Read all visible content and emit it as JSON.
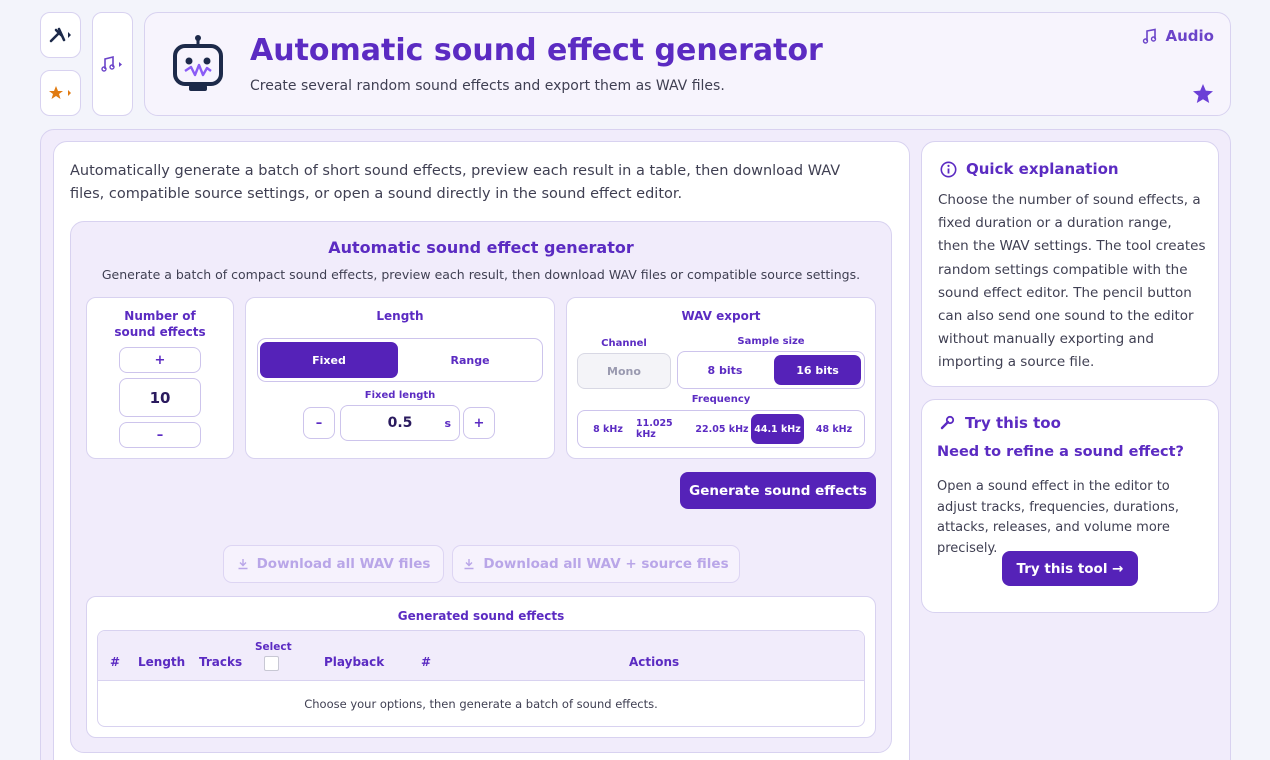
{
  "header": {
    "title": "Automatic sound effect generator",
    "subtitle": "Create several random sound effects and export them as WAV files.",
    "category": "Audio"
  },
  "intro": "Automatically generate a batch of short sound effects, preview each result in a table, then download WAV files, compatible source settings, or open a sound directly in the sound effect editor.",
  "tool": {
    "title": "Automatic sound effect generator",
    "subtitle": "Generate a batch of compact sound effects, preview each result, then download WAV files or compatible source settings.",
    "count": {
      "label_line1": "Number of",
      "label_line2": "sound effects",
      "plus": "+",
      "value": "10",
      "minus": "–"
    },
    "length": {
      "label": "Length",
      "mode_fixed": "Fixed",
      "mode_range": "Range",
      "fixed_label": "Fixed length",
      "minus": "–",
      "value": "0.5",
      "unit": "s",
      "plus": "+"
    },
    "wav": {
      "label": "WAV export",
      "channel_label": "Channel",
      "channel_value": "Mono",
      "sample_label": "Sample size",
      "sample_8": "8 bits",
      "sample_16": "16 bits",
      "freq_label": "Frequency",
      "freqs": [
        "8 kHz",
        "11.025 kHz",
        "22.05 kHz",
        "44.1 kHz",
        "48 kHz"
      ]
    },
    "generate": "Generate sound effects",
    "download_wav": "Download all WAV files",
    "download_wav_source": "Download all WAV + source files"
  },
  "results": {
    "title": "Generated sound effects",
    "columns": [
      "#",
      "Length",
      "Tracks",
      "Select",
      "Playback",
      "#",
      "Actions"
    ],
    "empty": "Choose your options, then generate a batch of sound effects."
  },
  "explanation": {
    "title": "Quick explanation",
    "body": "Choose the number of sound effects, a fixed duration or a duration range, then the WAV settings. The tool creates random settings compatible with the sound effect editor. The pencil button can also send one sound to the editor without manually exporting and importing a source file."
  },
  "try": {
    "title": "Try this too",
    "heading": "Need to refine a sound effect?",
    "body": "Open a sound effect in the editor to adjust tracks, frequencies, durations, attacks, releases, and volume more precisely.",
    "button": "Try this tool →"
  },
  "colors": {
    "accent": "#5522b8",
    "accent_text": "#5b2bc2",
    "panel": "#f1ecfb",
    "border": "#d8d2f0"
  }
}
